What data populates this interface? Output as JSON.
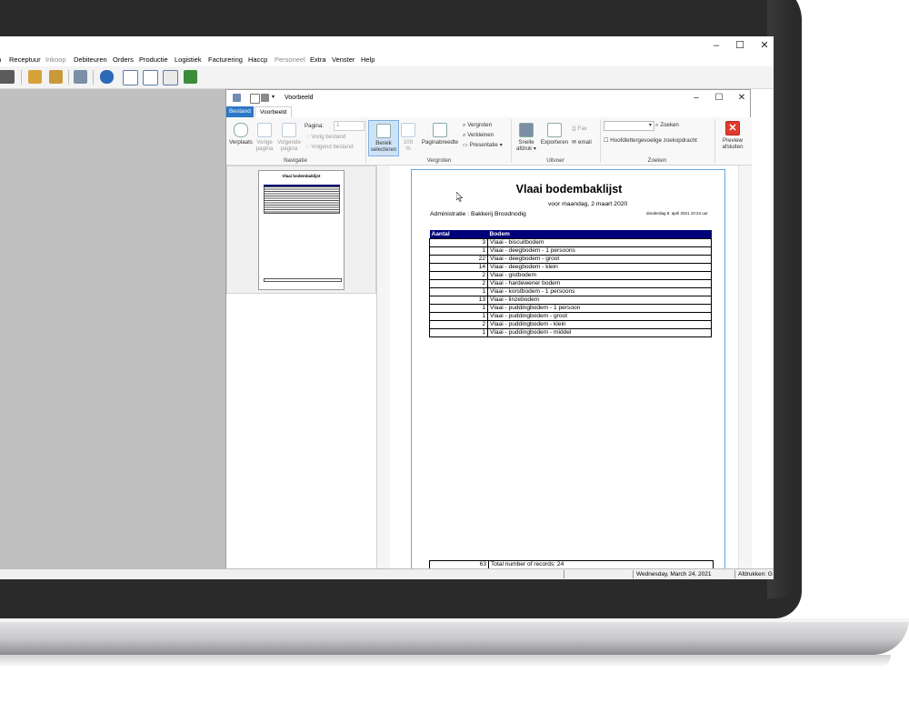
{
  "app": {
    "menu": [
      {
        "label": "n",
        "disabled": false
      },
      {
        "label": "Receptuur",
        "disabled": false
      },
      {
        "label": "Inkoop",
        "disabled": true
      },
      {
        "label": "Debiteuren",
        "disabled": false
      },
      {
        "label": "Orders",
        "disabled": false
      },
      {
        "label": "Productie",
        "disabled": false
      },
      {
        "label": "Logistiek",
        "disabled": false
      },
      {
        "label": "Facturering",
        "disabled": false
      },
      {
        "label": "Haccp",
        "disabled": false
      },
      {
        "label": "Personeel",
        "disabled": true
      },
      {
        "label": "Extra",
        "disabled": false
      },
      {
        "label": "Venster",
        "disabled": false
      },
      {
        "label": "Help",
        "disabled": false
      }
    ],
    "window_controls": {
      "minimize": "–",
      "maximize": "☐",
      "close": "✕"
    },
    "status": {
      "date": "Wednesday, March 24, 2021",
      "prints": "Afdrukken: G"
    }
  },
  "preview": {
    "title": "Voorbeeld",
    "tabs": {
      "file": "Bestand",
      "active": "Voorbeeld"
    },
    "ribbon": {
      "navigatie": {
        "label": "Navigatie",
        "verplaats": "Verplaats",
        "vorige_pagina": [
          "Vorige",
          "pagina"
        ],
        "volgende_pagina": [
          "Volgende",
          "pagina"
        ],
        "pagina_label": "Pagina:",
        "pagina_value": "1",
        "vorig_bestand": "Vorig bestand",
        "volgend_bestand": "Volgend bestand"
      },
      "vergroten": {
        "label": "Vergroten",
        "bereik": [
          "Bereik",
          "selecteren"
        ],
        "zoom": [
          "100",
          "%"
        ],
        "paginabreedte": "Paginabreedte",
        "vergroten": "Vergroten",
        "verkleinen": "Verkleinen",
        "presentatie": "Presentatie ▾"
      },
      "uitvoer": {
        "label": "Uitvoer",
        "snelle": [
          "Snelle",
          "afdruk ▾"
        ],
        "exporteren": "Exporteren",
        "fax": "Fax",
        "email": "email"
      },
      "zoeken": {
        "label": "Zoeken",
        "zoeken": "Zoeken",
        "hoofdletter": "Hoofdlettergevoelige zoekopdracht"
      },
      "sluiten": [
        "Preview",
        "afsluiten"
      ]
    }
  },
  "report": {
    "title": "Vlaai bodembaklijst",
    "subtitle": "voor maandag, 2 maart 2020",
    "admin": "Administratie : Bakkerij Broodnodig",
    "print_date": "donderdag 8. april 2021 10:24 uur",
    "columns": [
      "Aantal",
      "Bodem"
    ],
    "rows": [
      {
        "aantal": "3",
        "bodem": "Vlaai - biscuitbodem"
      },
      {
        "aantal": "1",
        "bodem": "Vlaai - deegbodem - 1 persoons"
      },
      {
        "aantal": "22",
        "bodem": "Vlaai - deegbodem - groot"
      },
      {
        "aantal": "14",
        "bodem": "Vlaai - deegbodem - klein"
      },
      {
        "aantal": "2",
        "bodem": "Vlaai - gistbodem"
      },
      {
        "aantal": "2",
        "bodem": "Vlaai - hardewener bodem"
      },
      {
        "aantal": "1",
        "bodem": "Vlaai - korstbodem - 1 persoons"
      },
      {
        "aantal": "13",
        "bodem": "Vlaai - linzebodem"
      },
      {
        "aantal": "1",
        "bodem": "Vlaai - puddingbodem - 1 persoon"
      },
      {
        "aantal": "1",
        "bodem": "Vlaai - puddingbodem - groot"
      },
      {
        "aantal": "2",
        "bodem": "Vlaai - puddingbodem - klein"
      },
      {
        "aantal": "1",
        "bodem": "Vlaai - puddingbodem - middel"
      }
    ],
    "footer": {
      "total": "63",
      "label": "Total number of records: 24"
    }
  },
  "thumbnail": {
    "title": "Vlaai bodembaklijst"
  },
  "colors": {
    "accent": "#2b78c8",
    "table_header": "#00007a",
    "workspace": "#c0c0c0",
    "close_red": "#e03a2e"
  }
}
